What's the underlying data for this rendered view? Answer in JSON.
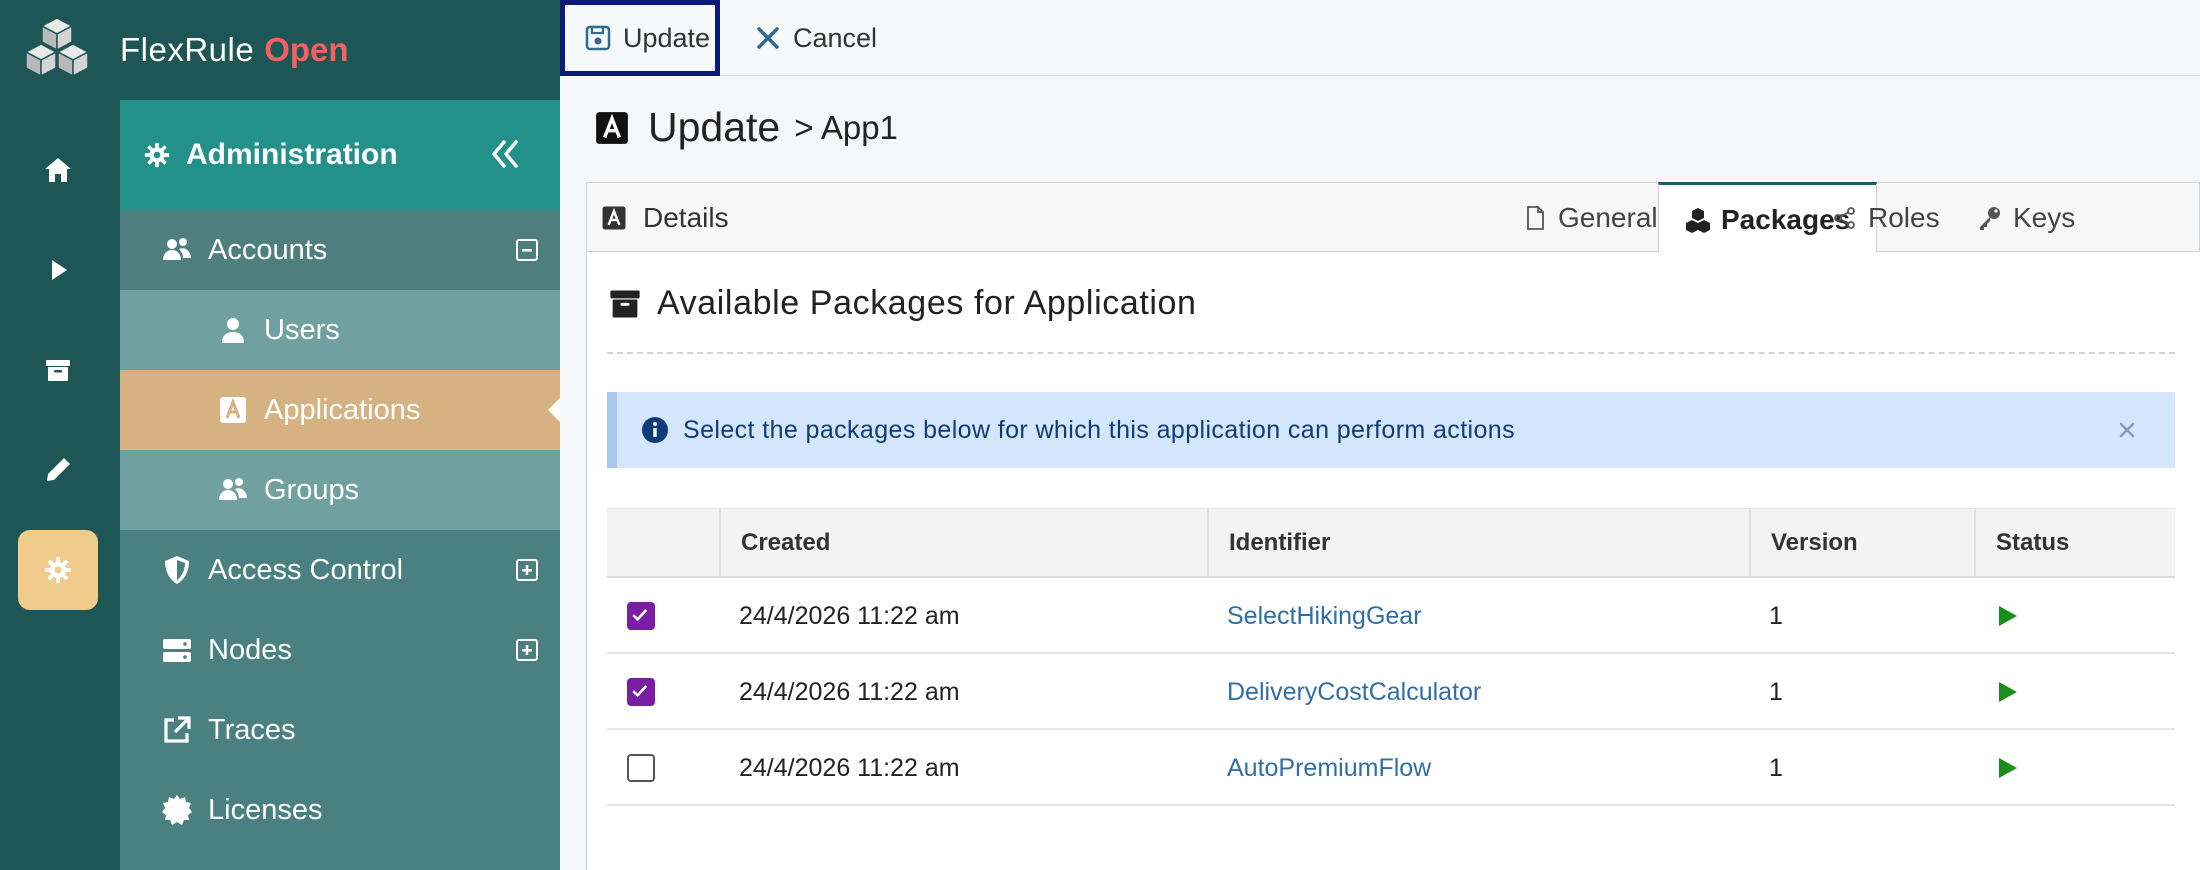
{
  "brand": {
    "name": "FlexRule",
    "accent": "Open"
  },
  "colors": {
    "rail": "#1e5555",
    "sidebar": "#4a8080",
    "admin_header": "#23918a",
    "selected_item": "#d6b283",
    "active_rail": "#f0cc8c",
    "checkbox": "#7b1fa2",
    "status": "#1a8f1a"
  },
  "rail": {
    "items": [
      {
        "icon": "home-icon"
      },
      {
        "icon": "play-icon"
      },
      {
        "icon": "archive-icon"
      },
      {
        "icon": "pencil-icon"
      },
      {
        "icon": "gear-icon",
        "active": true
      }
    ]
  },
  "sidebar": {
    "header": "Administration",
    "items": [
      {
        "label": "Accounts",
        "icon": "users-icon",
        "toggle": "minus"
      },
      {
        "label": "Users",
        "icon": "user-icon"
      },
      {
        "label": "Applications",
        "icon": "app-icon",
        "selected": true
      },
      {
        "label": "Groups",
        "icon": "users-icon"
      },
      {
        "label": "Access Control",
        "icon": "shield-icon",
        "toggle": "plus"
      },
      {
        "label": "Nodes",
        "icon": "server-icon",
        "toggle": "plus"
      },
      {
        "label": "Traces",
        "icon": "external-link-icon"
      },
      {
        "label": "Licenses",
        "icon": "badge-icon"
      }
    ]
  },
  "toolbar": {
    "update_label": "Update",
    "cancel_label": "Cancel"
  },
  "page": {
    "title": "Update",
    "crumb": "> App1"
  },
  "tabs": {
    "details": "Details",
    "general": "General",
    "packages": "Packages",
    "roles": "Roles",
    "keys": "Keys",
    "active": "Packages"
  },
  "panel": {
    "title": "Available Packages for Application",
    "alert": "Select the packages below for which this application can perform actions"
  },
  "table": {
    "columns": [
      "Created",
      "Identifier",
      "Version",
      "Status"
    ],
    "rows": [
      {
        "checked": true,
        "created": "24/4/2026 11:22 am",
        "identifier": "SelectHikingGear",
        "version": "1",
        "status": "play"
      },
      {
        "checked": true,
        "created": "24/4/2026 11:22 am",
        "identifier": "DeliveryCostCalculator",
        "version": "1",
        "status": "play"
      },
      {
        "checked": false,
        "created": "24/4/2026 11:22 am",
        "identifier": "AutoPremiumFlow",
        "version": "1",
        "status": "play"
      }
    ]
  }
}
